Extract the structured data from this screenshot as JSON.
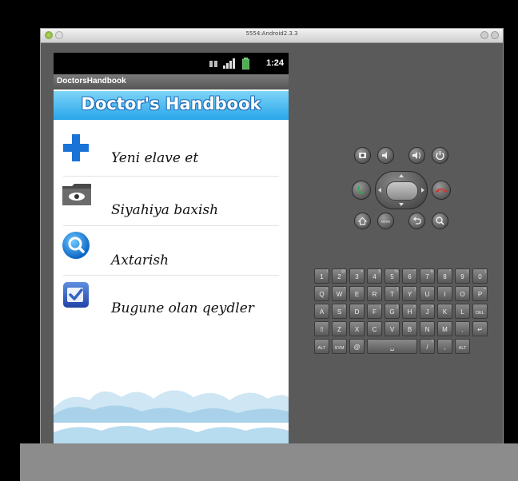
{
  "window": {
    "title": "5554:Android2.3.3"
  },
  "status_bar": {
    "time": "1:24"
  },
  "app": {
    "title": "DoctorsHandbook",
    "banner": "Doctor's Handbook"
  },
  "menu": {
    "items": [
      {
        "label": "Yeni elave et",
        "icon": "plus-icon"
      },
      {
        "label": "Siyahiya baxish",
        "icon": "folder-eye-icon"
      },
      {
        "label": "Axtarish",
        "icon": "search-icon"
      },
      {
        "label": "Bugune olan qeydler",
        "icon": "checkbox-icon"
      }
    ]
  },
  "keyboard": {
    "row1": [
      {
        "k": "1",
        "a": "!"
      },
      {
        "k": "2",
        "a": "@"
      },
      {
        "k": "3",
        "a": "#"
      },
      {
        "k": "4",
        "a": "$"
      },
      {
        "k": "5",
        "a": "%"
      },
      {
        "k": "6",
        "a": "^"
      },
      {
        "k": "7",
        "a": "&"
      },
      {
        "k": "8",
        "a": "*"
      },
      {
        "k": "9",
        "a": "("
      },
      {
        "k": "0",
        "a": ")"
      }
    ],
    "row2": [
      {
        "k": "Q",
        "a": "~"
      },
      {
        "k": "W",
        "a": "\""
      },
      {
        "k": "E",
        "a": ""
      },
      {
        "k": "R",
        "a": ""
      },
      {
        "k": "T",
        "a": "{"
      },
      {
        "k": "Y",
        "a": "}"
      },
      {
        "k": "U",
        "a": "-"
      },
      {
        "k": "I",
        "a": ""
      },
      {
        "k": "O",
        "a": ""
      },
      {
        "k": "P",
        "a": "="
      }
    ],
    "row3": [
      {
        "k": "A",
        "a": ""
      },
      {
        "k": "S",
        "a": "\\"
      },
      {
        "k": "D",
        "a": "'"
      },
      {
        "k": "F",
        "a": "["
      },
      {
        "k": "G",
        "a": "]"
      },
      {
        "k": "H",
        "a": "<"
      },
      {
        "k": "J",
        "a": ">"
      },
      {
        "k": "K",
        "a": ";"
      },
      {
        "k": "L",
        "a": ":"
      },
      {
        "k": "DEL",
        "a": ""
      }
    ],
    "row4": [
      {
        "k": "⇧",
        "a": ""
      },
      {
        "k": "Z",
        "a": ""
      },
      {
        "k": "X",
        "a": ""
      },
      {
        "k": "C",
        "a": ""
      },
      {
        "k": "V",
        "a": ""
      },
      {
        "k": "B",
        "a": ""
      },
      {
        "k": "N",
        "a": ""
      },
      {
        "k": "M",
        "a": ""
      },
      {
        "k": ".",
        "a": ""
      },
      {
        "k": "↵",
        "a": ""
      }
    ],
    "row5": [
      {
        "k": "ALT",
        "a": ""
      },
      {
        "k": "SYM",
        "a": ""
      },
      {
        "k": "@",
        "a": ""
      },
      {
        "k": "␣",
        "a": ""
      },
      {
        "k": "/",
        "a": "?"
      },
      {
        "k": ",",
        "a": ""
      },
      {
        "k": "ALT",
        "a": ""
      }
    ]
  },
  "colors": {
    "banner_top": "#7fd4f8",
    "banner_bottom": "#27a6ea",
    "plus_blue": "#1a73d6",
    "call_green": "#2fa84f",
    "end_red": "#d8332e"
  }
}
